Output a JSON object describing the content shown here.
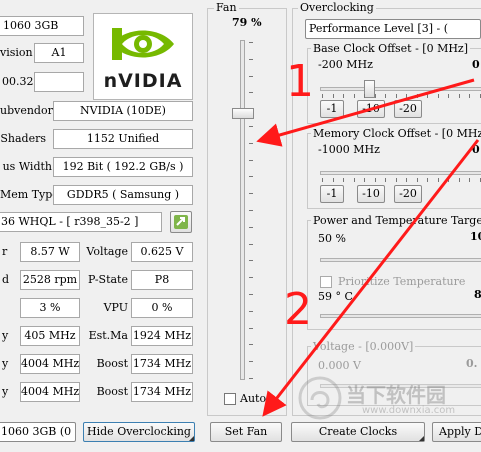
{
  "left": {
    "top_name_fragment": "1060 3GB",
    "bios_label": "vision",
    "bios_value": "A1",
    "driver_fragment": "00.32",
    "subvendor_label": "ubvendor",
    "subvendor_value": "NVIDIA (10DE)",
    "shaders_label": "Shaders",
    "shaders_value": "1152 Unified",
    "bus_label": "us Width",
    "bus_value": "192 Bit ( 192.2 GB/s )",
    "memtype_label": "Mem Type",
    "memtype_value": "GDDR5 ( Samsung )",
    "driver_value": "36 WHQL - [ r398_35-2 ]",
    "logo_text": "nVIDIA",
    "rows": [
      {
        "l1": "r",
        "v1": "8.57 W",
        "l2": "Voltage",
        "v2": "0.625 V"
      },
      {
        "l1": "d",
        "v1": "2528 rpm",
        "l2": "P-State",
        "v2": "P8"
      },
      {
        "l1": "",
        "v1": "3 %",
        "l2": "VPU",
        "v2": "0 %"
      },
      {
        "l1": "y",
        "v1": "405 MHz",
        "l2": "Est.Ma",
        "v2": "1924 MHz"
      },
      {
        "l1": "y",
        "v1": "4004 MHz",
        "l2": "Boost",
        "v2": "1734 MHz"
      },
      {
        "l1": "y",
        "v1": "4004 MHz",
        "l2": "Boost",
        "v2": "1734 MHz"
      }
    ],
    "gpu_select": "1060 3GB (0",
    "hide_oc_button": "Hide Overclocking"
  },
  "fan": {
    "title": "Fan",
    "percent": "79 %",
    "level": 0.79,
    "auto_label": "Auto",
    "set_fan_button": "Set Fan"
  },
  "oc": {
    "title": "Overclocking",
    "perf_level": "Performance Level [3] - (",
    "base_clock_label": "Base Clock Offset - [0 MHz]",
    "base_clock_min": "-200 MHz",
    "base_clock_right": "0",
    "mem_clock_label": "Memory Clock Offset - [0 MHz",
    "mem_clock_min": "-1000 MHz",
    "mem_clock_right": "0",
    "step_buttons": [
      "-1",
      "-10",
      "-20"
    ],
    "power_temp_label": "Power and Temperature Target",
    "power_value": "50 %",
    "power_right": "10",
    "prioritize_label": "Prioritize Temperature",
    "temp_value": "59 ° C",
    "temp_right": "8",
    "voltage_label": "Voltage - [0.000V]",
    "voltage_value": "0.000 V",
    "voltage_right": "0.",
    "create_clocks_button": "Create Clocks",
    "apply_button": "Apply D"
  },
  "annotations": {
    "mark1": "1",
    "mark2": "2"
  },
  "watermark": {
    "cn": "当下软件园",
    "url": "www.downxia.com"
  },
  "colors": {
    "nvidia_green": "#76b900",
    "annotation_red": "#ff1a1a"
  }
}
